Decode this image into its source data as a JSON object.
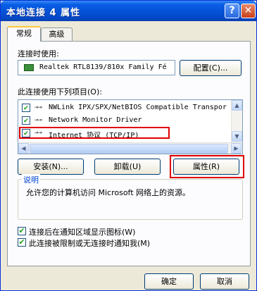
{
  "window": {
    "title": "本地连接 4 属性"
  },
  "title_buttons": {
    "help": "?",
    "close": "✕"
  },
  "tabs": [
    {
      "label": "常规"
    },
    {
      "label": "高级"
    }
  ],
  "connection": {
    "label": "连接时使用:",
    "adapter_name": "Realtek RTL8139/810x Family Fé",
    "configure_button": "配置(C)..."
  },
  "components": {
    "label": "此连接使用下列项目(O):",
    "items": [
      {
        "label": "NWLink IPX/SPX/NetBIOS Compatible Transpor",
        "checked": true
      },
      {
        "label": "Network Monitor Driver",
        "checked": true
      },
      {
        "label": "Internet 协议 (TCP/IP)",
        "checked": true
      }
    ]
  },
  "action_buttons": {
    "install": "安装(N)...",
    "uninstall": "卸载(U)",
    "properties": "属性(R)"
  },
  "description": {
    "title": "说明",
    "text": "允许您的计算机访问 Microsoft 网络上的资源。"
  },
  "options": [
    {
      "label": "连接后在通知区域显示图标(W)",
      "checked": true
    },
    {
      "label": "此连接被限制或无连接时通知我(M)",
      "checked": true
    }
  ],
  "footer": {
    "ok": "确定",
    "cancel": "取消"
  },
  "colors": {
    "highlight": "#e00000",
    "title_bar": "#0453d8"
  }
}
